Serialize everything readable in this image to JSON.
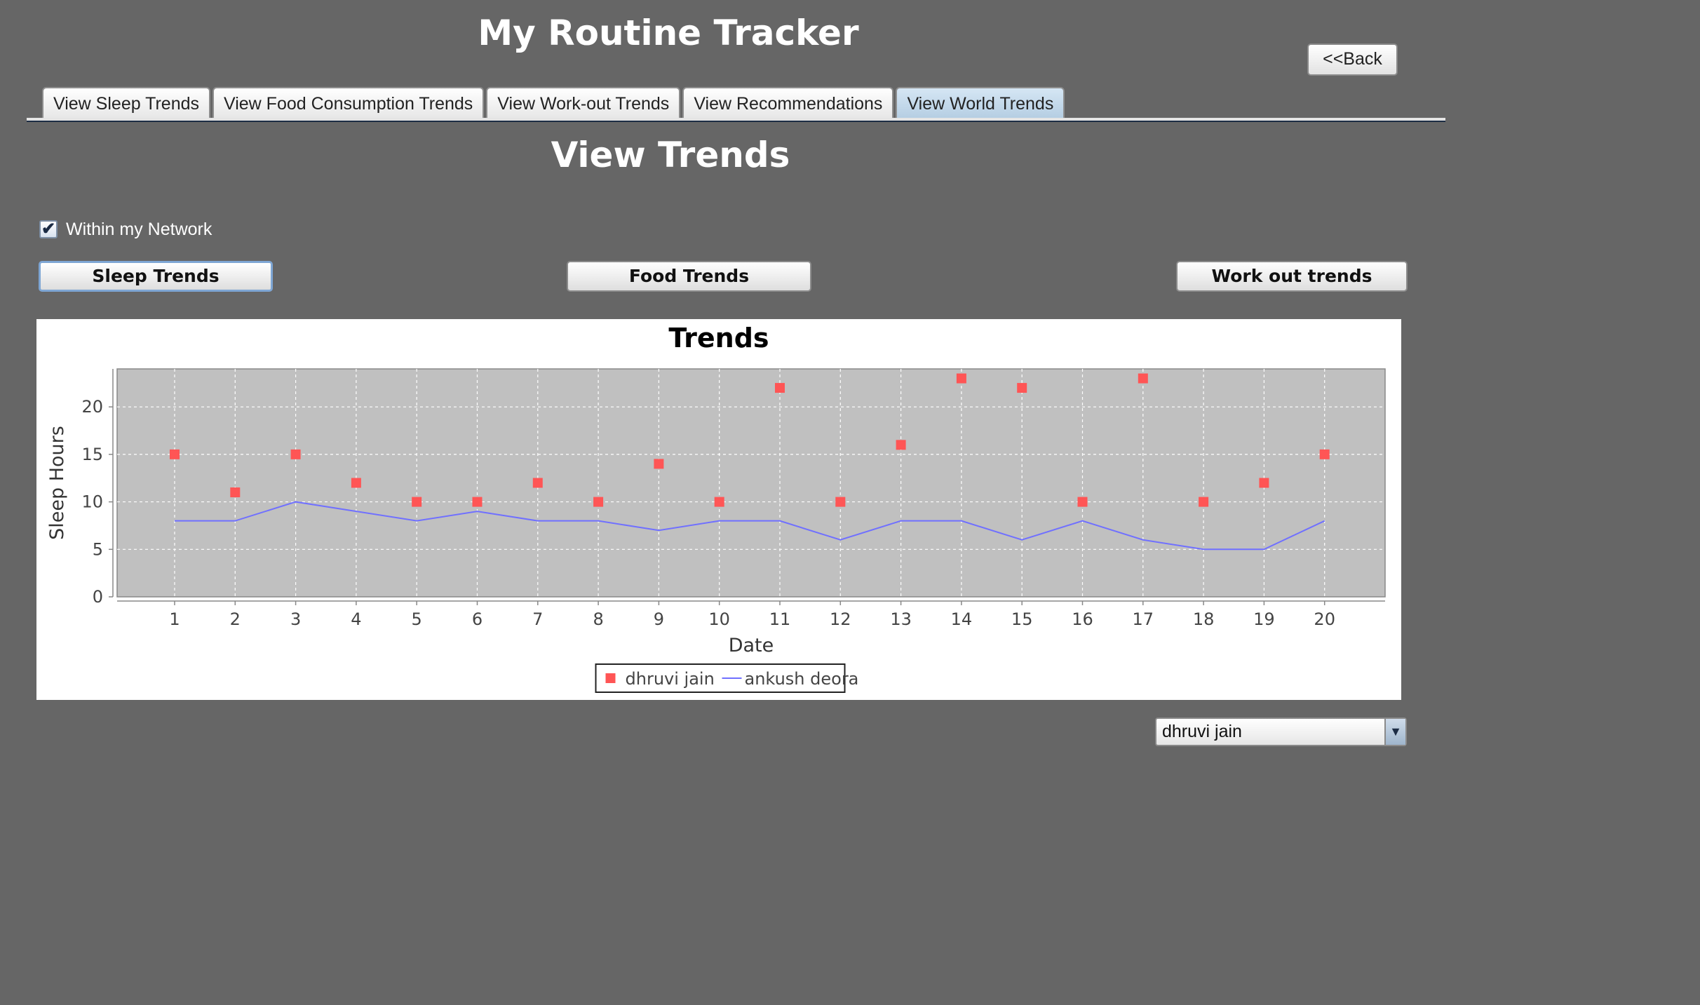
{
  "app": {
    "title": "My Routine Tracker",
    "back_label": "<<Back"
  },
  "tabs": [
    {
      "label": "View Sleep Trends",
      "active": false
    },
    {
      "label": "View Food Consumption Trends",
      "active": false
    },
    {
      "label": "View Work-out Trends",
      "active": false
    },
    {
      "label": "View Recommendations",
      "active": false
    },
    {
      "label": "View World Trends",
      "active": true
    }
  ],
  "page": {
    "title": "View Trends",
    "network_checkbox": {
      "label": "Within my Network",
      "checked": true,
      "check_glyph": "✔"
    },
    "buttons": {
      "sleep": "Sleep Trends",
      "food": "Food Trends",
      "workout": "Work out trends"
    },
    "person_select": {
      "value": "dhruvi jain",
      "arrow_glyph": "▼"
    }
  },
  "chart_data": {
    "type": "scatter",
    "title": "Trends",
    "xlabel": "Date",
    "ylabel": "Sleep Hours",
    "x": [
      1,
      2,
      3,
      4,
      5,
      6,
      7,
      8,
      9,
      10,
      11,
      12,
      13,
      14,
      15,
      16,
      17,
      18,
      19,
      20
    ],
    "xlim": [
      0.05,
      21.0
    ],
    "ylim": [
      0,
      24
    ],
    "yticks": [
      0,
      5,
      10,
      15,
      20
    ],
    "grid": true,
    "legend_position": "bottom-center",
    "series": [
      {
        "name": "dhruvi jain",
        "mark": "square",
        "color": "#ff5555",
        "values": [
          15,
          11,
          15,
          12,
          10,
          10,
          12,
          10,
          14,
          10,
          22,
          10,
          16,
          23,
          22,
          10,
          23,
          10,
          12,
          15
        ]
      },
      {
        "name": "ankush deora",
        "mark": "line",
        "color": "#7070ff",
        "values": [
          8,
          8,
          10,
          9,
          8,
          9,
          8,
          8,
          7,
          8,
          8,
          6,
          8,
          8,
          6,
          8,
          6,
          5,
          5,
          8
        ]
      }
    ],
    "colors": {
      "plot_background": "#c0c0c0",
      "grid": "#ffffff",
      "axis_text": "#444444"
    }
  }
}
